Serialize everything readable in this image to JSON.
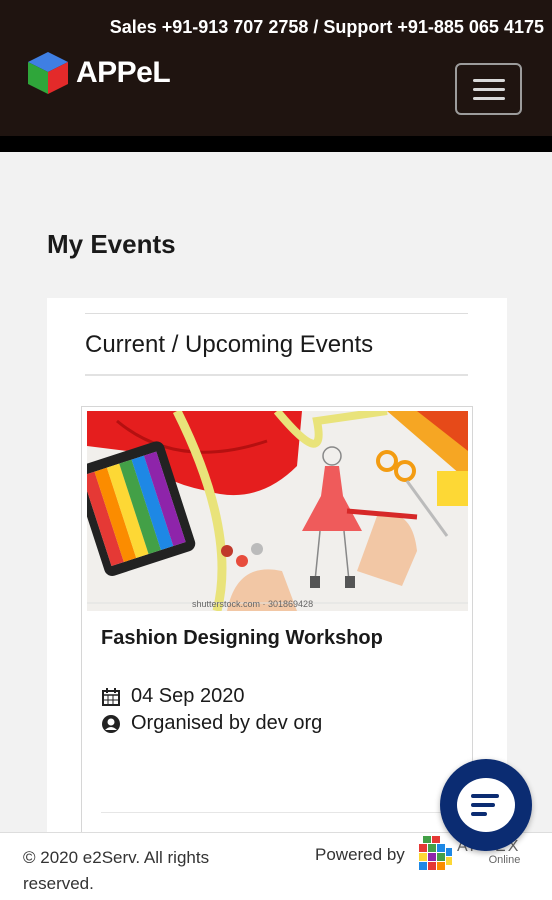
{
  "header": {
    "contact_line": "Sales   +91-913 707 2758 / Support   +91-885 065 4175",
    "logo_text": "APPeL",
    "menu_icon": "hamburger-icon"
  },
  "page": {
    "title": "My Events"
  },
  "events_section": {
    "title": "Current / Upcoming Events",
    "events": [
      {
        "title": "Fashion Designing Workshop",
        "date": "04 Sep 2020",
        "organiser": "Organised by dev org",
        "image_caption": "shutterstock.com · 301869428"
      }
    ]
  },
  "footer": {
    "copyright": "© 2020 e2Serv. All rights reserved.",
    "powered_by": "Powered by",
    "appex_name": "APPEX",
    "appex_sub": "Online"
  },
  "chat": {
    "icon": "chat-icon"
  },
  "colors": {
    "header_bg": "#1f1410",
    "chat_bg": "#0b2c72"
  }
}
